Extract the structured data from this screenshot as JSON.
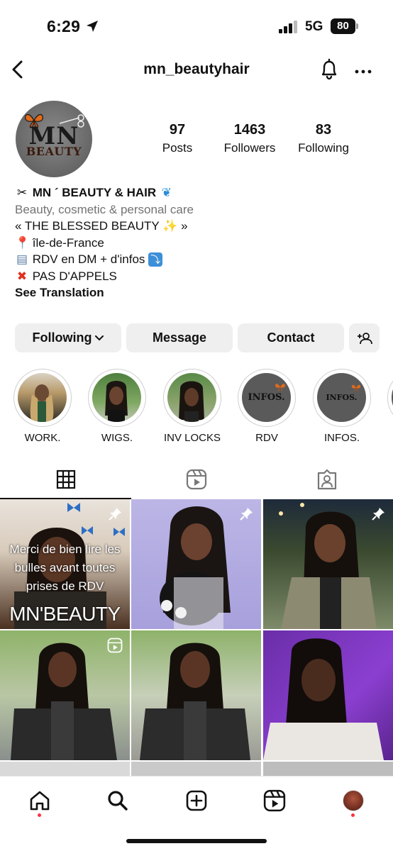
{
  "status_bar": {
    "time": "6:29",
    "network": "5G",
    "battery": "80"
  },
  "header": {
    "username": "mn_beautyhair"
  },
  "profile": {
    "avatar_text_top": "MN",
    "avatar_text_bottom": "BEAUTY",
    "stats": [
      {
        "value": "97",
        "label": "Posts"
      },
      {
        "value": "1463",
        "label": "Followers"
      },
      {
        "value": "83",
        "label": "Following"
      }
    ],
    "bio": {
      "name": "MN ´ BEAUTY & HAIR",
      "category": "Beauty, cosmetic & personal care",
      "line1": "« THE BLESSED BEAUTY ✨ »",
      "line2": "île-de-France",
      "line3": "RDV en DM + d'infos",
      "line4": "PAS D'APPELS",
      "see_translation": "See Translation"
    }
  },
  "actions": {
    "following": "Following",
    "message": "Message",
    "contact": "Contact"
  },
  "highlights": [
    {
      "label": "WORK."
    },
    {
      "label": "WIGS."
    },
    {
      "label": "INV LOCKS"
    },
    {
      "label": "RDV",
      "inner_text": "INFOS."
    },
    {
      "label": "INFOS.",
      "inner_text": "INFOS."
    }
  ],
  "posts": {
    "post1_text": "Merci de bien lire les bulles avant toutes prises de RDV",
    "post1_brand": "MN'BEAUTY"
  },
  "colors": {
    "accent_red": "#ff3040",
    "button_bg": "#efefef",
    "muted": "#737373"
  }
}
